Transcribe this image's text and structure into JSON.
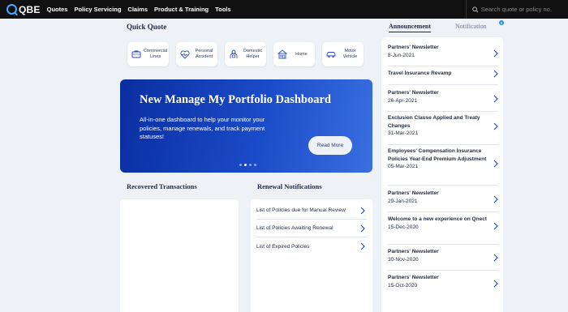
{
  "brand": {
    "name": "QBE",
    "accent": "#4da8ff"
  },
  "nav": {
    "items": [
      "Quotes",
      "Policy Servicing",
      "Claims",
      "Product & Training",
      "Tools"
    ],
    "search_placeholder": "Search quote or policy no."
  },
  "quick_quote": {
    "title": "Quick Quote",
    "cards": [
      {
        "label": "Commercial Lines",
        "icon": "commercial-lines-icon"
      },
      {
        "label": "Personal Accident",
        "icon": "heart-pulse-icon"
      },
      {
        "label": "Domestic Helper",
        "icon": "helper-icon"
      },
      {
        "label": "Home",
        "icon": "home-icon"
      },
      {
        "label": "Motor Vehicle",
        "icon": "car-icon"
      }
    ]
  },
  "banner": {
    "title": "New Manage My Portfolio Dashboard",
    "description": "All-in-one dashboard to help your monitor your policies, manage renewals, and track payment statuses!",
    "button": "Read More",
    "slide_count": 4,
    "active_slide": 2
  },
  "recovered": {
    "title": "Recovered Transactions"
  },
  "renewal": {
    "title": "Renewal Notifications",
    "items": [
      "List of Policies due for Manual Review",
      "List of Policies Awaiting Renewal",
      "List of Expired Policies"
    ]
  },
  "side": {
    "tabs": [
      "Announcement",
      "Notification"
    ],
    "notification_badge": "0",
    "announcements": [
      {
        "title": "Partners' Newsletter",
        "date": "8-Jun-2021"
      },
      {
        "title": "Travel Insurance Revamp",
        "date": ""
      },
      {
        "title": "Partners' Newsletter",
        "date": "26-Apr-2021"
      },
      {
        "title": "Exclusion Clause Applied and Treaty Changes",
        "date": "31-Mar-2021"
      },
      {
        "title": "Employees' Compensation Insurance Policies Year-End Premium Adjustment",
        "date": "05-Mar-2021"
      },
      {
        "title": "Partners' Newsletter",
        "date": "29-Jan-2021"
      },
      {
        "title": "Welcome to a new experience on Qnect",
        "date": "15-Dec-2020"
      },
      {
        "title": "Partners' Newsletter",
        "date": "30-Nov-2020"
      },
      {
        "title": "Partners' Newsletter",
        "date": "15-Oct-2020"
      }
    ]
  }
}
